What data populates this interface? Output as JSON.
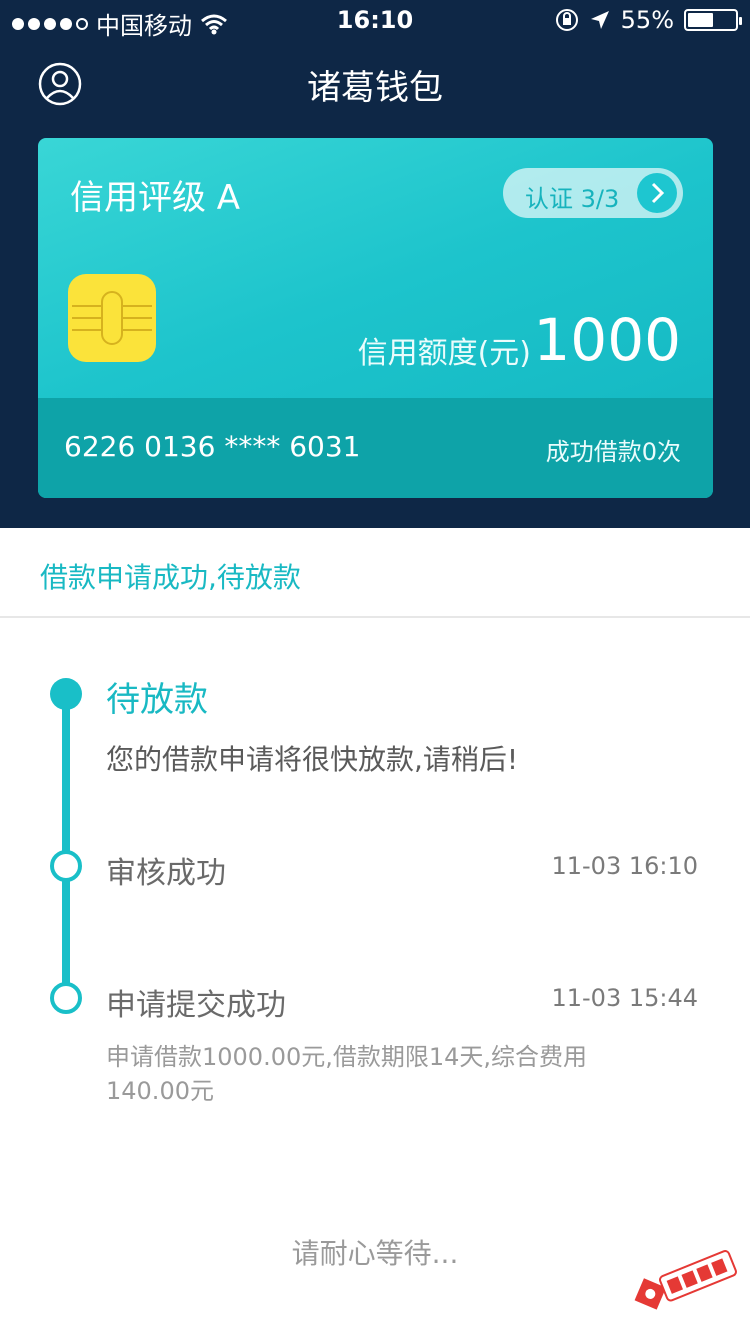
{
  "status_bar": {
    "carrier": "中国移动",
    "time": "16:10",
    "battery": "55%",
    "battery_level": 0.55
  },
  "header": {
    "title": "诸葛钱包"
  },
  "card": {
    "rating": "信用评级 A",
    "certify_label": "认证 3/3",
    "limit_label": "信用额度(元)",
    "limit_value": "1000",
    "card_number": "6226 0136 **** 6031",
    "loan_count": "成功借款0次"
  },
  "notice": {
    "text": "借款申请成功,待放款"
  },
  "timeline": {
    "steps": [
      {
        "title": "待放款",
        "desc": "您的借款申请将很快放款,请稍后!"
      },
      {
        "title": "审核成功",
        "time": "11-03 16:10"
      },
      {
        "title": "申请提交成功",
        "time": "11-03 15:44",
        "detail": "申请借款1000.00元,借款期限14天,综合费用140.00元"
      }
    ]
  },
  "footer": {
    "wait_text": "请耐心等待..."
  },
  "watermark": {
    "text": "卡农社区"
  },
  "colors": {
    "header_bg": "#0e2746",
    "accent": "#19bfc8",
    "chip": "#fbe33a"
  }
}
